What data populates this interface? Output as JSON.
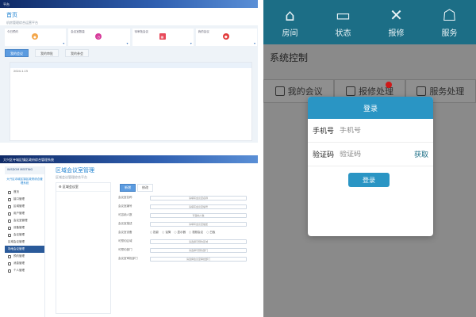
{
  "panel1": {
    "topbar": "平台",
    "page_title": "首页",
    "page_subtitle": "机房管理综合运营平台",
    "cards": [
      {
        "label": "今日预约",
        "icon": "person-icon",
        "color": "#f3a64a"
      },
      {
        "label": "会议室数量",
        "icon": "clock-icon",
        "color": "#d63a9a"
      },
      {
        "label": "待审批会议",
        "icon": "calendar-icon",
        "color": "#e84a5a"
      },
      {
        "label": "我的会议",
        "icon": "user-icon",
        "color": "#e23b3b"
      }
    ],
    "tabs": [
      {
        "label": "我的会议",
        "active": true
      },
      {
        "label": "我的审批",
        "active": false
      },
      {
        "label": "我的参会",
        "active": false
      }
    ],
    "table_row": "2024-1-15"
  },
  "panel2": {
    "topbar": "大兴区寺城区镇区政府综合管理系统",
    "logo": "WISDOM MEETING",
    "org": "大兴区寺城区镇区政府综合管理系统",
    "menu": [
      {
        "label": "首页",
        "selected": false
      },
      {
        "label": "接口管理",
        "selected": false
      },
      {
        "label": "区域管理",
        "selected": false
      },
      {
        "label": "用户管理",
        "selected": false
      },
      {
        "label": "会议室管理",
        "selected": false
      },
      {
        "label": "设备管理",
        "selected": false
      },
      {
        "label": "会议管理",
        "selected": false
      },
      {
        "label": "区域会议管理",
        "selected": false
      },
      {
        "label": "场地会议管理",
        "selected": true
      },
      {
        "label": "预约管理",
        "selected": false
      },
      {
        "label": "消息管理",
        "selected": false
      },
      {
        "label": "个人管理",
        "selected": false
      }
    ],
    "page_title": "区域会议室管理",
    "page_subtitle": "区域会议管理综合平台",
    "tree_header": "区域会议室",
    "form_tabs": [
      {
        "label": "新增",
        "active": true
      },
      {
        "label": "修改",
        "active": false
      }
    ],
    "form_rows": [
      {
        "label": "会议室名称",
        "placeholder": "请填写会议室名称"
      },
      {
        "label": "会议室编号",
        "placeholder": "请填写会议室编号"
      },
      {
        "label": "可容纳人数",
        "placeholder": "可容纳人数"
      },
      {
        "label": "会议室描述",
        "placeholder": "请填写会议室描述"
      },
      {
        "label": "会议室设备",
        "radios": [
          "投影",
          "话筒",
          "显示器",
          "视频会议",
          "白板"
        ]
      },
      {
        "label": "可预约区域",
        "placeholder": "请选择可预约区域"
      },
      {
        "label": "可预约部门",
        "placeholder": "请选择可预约部门"
      },
      {
        "label": "会议室审批部门",
        "placeholder": "请选择会议室审批部门"
      }
    ]
  },
  "panel3": {
    "nav": [
      {
        "label": "房间",
        "icon": "house-icon",
        "glyph": "⌂"
      },
      {
        "label": "状态",
        "icon": "monitor-icon",
        "glyph": "▭"
      },
      {
        "label": "报修",
        "icon": "tools-icon",
        "glyph": "✕"
      },
      {
        "label": "服务",
        "icon": "service-icon",
        "glyph": "☖"
      }
    ],
    "title": "系统控制",
    "tabs": [
      {
        "label": "我的会议",
        "icon": "house-icon"
      },
      {
        "label": "报修处理",
        "icon": "tools-icon",
        "badge": true
      },
      {
        "label": "服务处理",
        "icon": "service-icon"
      }
    ],
    "modal": {
      "title": "登录",
      "phone_label": "手机号",
      "phone_placeholder": "手机号",
      "code_label": "验证码",
      "code_placeholder": "验证码",
      "get_code": "获取",
      "submit": "登录"
    }
  }
}
